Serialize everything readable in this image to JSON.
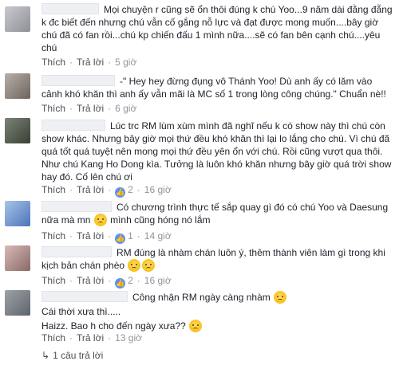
{
  "comments": [
    {
      "name_width": 72,
      "text": "Mọi chuyện r cũng sẽ ổn thôi đúng k chú Yoo...9 năm dài đằng đẵng k đc biết đến nhưng chú vẫn cố gắng nỗ lực và đạt được mong muốn....bây giờ chú đã có fan rồi...chú kp chiến đấu 1 mình nữa....sẽ có fan bên cạnh chú....yêu chú",
      "like": "Thích",
      "reply": "Trả lời",
      "time": "5 giờ"
    },
    {
      "name_width": 92,
      "text": "-\" Hey hey đừng đụng vô Thánh Yoo! Dù anh ấy có lăm vào cảnh khó khăn thì anh ấy vẫn mãi là MC số 1 trong lòng công chúng.\" Chuẩn nè!!",
      "like": "Thích",
      "reply": "Trả lời",
      "time": "6 giờ"
    },
    {
      "name_width": 80,
      "text": "Lúc trc RM lùm xùm mình đã nghĩ nếu k có show này thì chú còn show khác. Nhưng bây giờ mọi thứ đều khó khăn thì lại lo lắng cho chú. Vì chú đã quá tốt quá tuyệt nên mong mọi thứ đều yên ổn với chú. Rồi cũng vượt qua thôi. Như chú Kang Ho Dong kìa. Tưởng là luôn khó khăn nhưng bây giờ quá trời show hay đó. Cố lên chú ơi",
      "like": "Thích",
      "reply": "Trả lời",
      "likes": "2",
      "time": "16 giờ"
    },
    {
      "name_width": 88,
      "text_a": "Có chương trình thực tế sắp quay gì đó có chú Yoo và Daesung nữa mà mn",
      "text_b": "mình cũng hóng nó lắm",
      "like": "Thích",
      "reply": "Trả lời",
      "likes": "1",
      "time": "14 giờ"
    },
    {
      "name_width": 88,
      "text": "RM đúng là nhàm chán luôn ý, thêm thành viên làm gì trong khi kịch bản chán phèo",
      "like": "Thích",
      "reply": "Trả lời",
      "likes": "2",
      "time": "16 giờ"
    },
    {
      "name_width": 108,
      "line1": "Công nhận RM ngày càng nhàm",
      "line2": "Cái thời xưa thì.....",
      "line3": "Haizz. Bao h cho đến ngày xưa??",
      "like": "Thích",
      "reply": "Trả lời",
      "time": "13 giờ"
    }
  ],
  "reply_thread": "1 câu trả lời",
  "colors": {
    "link": "#4b4f56",
    "meta": "#90949c",
    "like_badge": "#5890ff",
    "text": "#1d2129"
  }
}
